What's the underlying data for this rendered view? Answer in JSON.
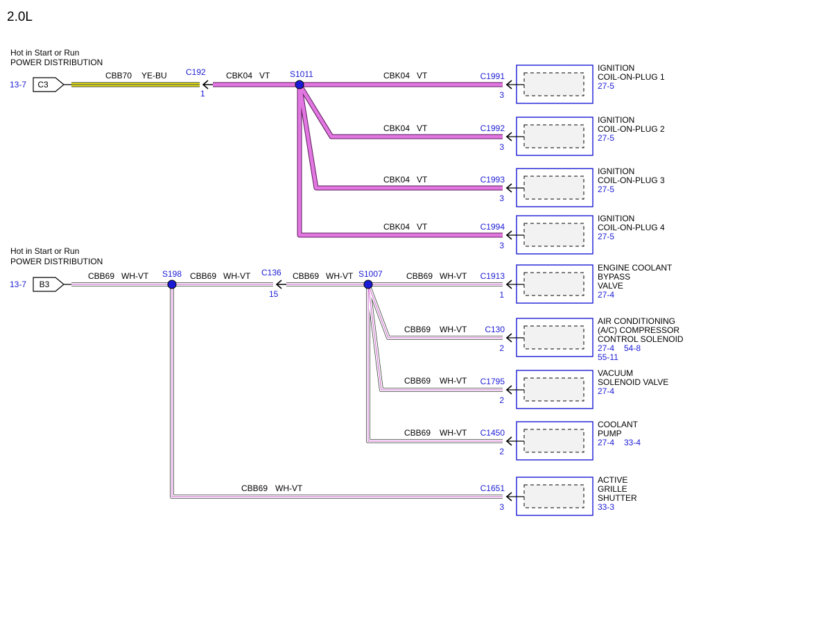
{
  "diagram": {
    "title": "2.0L",
    "sources": [
      {
        "id": "c3",
        "line1": "Hot in Start or Run",
        "line2": "POWER DISTRIBUTION",
        "ref": "13-7",
        "terminal": "C3"
      },
      {
        "id": "b3",
        "line1": "Hot in Start or Run",
        "line2": "POWER DISTRIBUTION",
        "ref": "13-7",
        "terminal": "B3"
      }
    ],
    "circuits": {
      "cbb70": "CBB70",
      "cbb70_color": "YE-BU",
      "cbk04": "CBK04",
      "cbk04_color": "VT",
      "cbb69": "CBB69",
      "cbb69_color": "WH-VT"
    },
    "connectors": {
      "c192": "C192",
      "c192_pin": "1",
      "c136": "C136",
      "c136_pin": "15"
    },
    "splices": {
      "s1011": "S1011",
      "s198": "S198",
      "s1007": "S1007"
    },
    "components": [
      {
        "connector": "C1991",
        "pin": "3",
        "name": [
          "IGNITION",
          "COIL-ON-PLUG 1"
        ],
        "refs": [
          "27-5"
        ]
      },
      {
        "connector": "C1992",
        "pin": "3",
        "name": [
          "IGNITION",
          "COIL-ON-PLUG 2"
        ],
        "refs": [
          "27-5"
        ]
      },
      {
        "connector": "C1993",
        "pin": "3",
        "name": [
          "IGNITION",
          "COIL-ON-PLUG 3"
        ],
        "refs": [
          "27-5"
        ]
      },
      {
        "connector": "C1994",
        "pin": "3",
        "name": [
          "IGNITION",
          "COIL-ON-PLUG 4"
        ],
        "refs": [
          "27-5"
        ]
      },
      {
        "connector": "C1913",
        "pin": "1",
        "name": [
          "ENGINE COOLANT",
          "BYPASS",
          "VALVE"
        ],
        "refs": [
          "27-4"
        ]
      },
      {
        "connector": "C130",
        "pin": "2",
        "name": [
          "AIR CONDITIONING",
          "(A/C) COMPRESSOR",
          "CONTROL SOLENOID"
        ],
        "refs": [
          "27-4",
          "54-8",
          "55-11"
        ]
      },
      {
        "connector": "C1795",
        "pin": "2",
        "name": [
          "VACUUM",
          "SOLENOID VALVE"
        ],
        "refs": [
          "27-4"
        ]
      },
      {
        "connector": "C1450",
        "pin": "2",
        "name": [
          "COOLANT",
          "PUMP"
        ],
        "refs": [
          "27-4",
          "33-4"
        ]
      },
      {
        "connector": "C1651",
        "pin": "3",
        "name": [
          "ACTIVE",
          "GRILLE",
          "SHUTTER"
        ],
        "refs": [
          "33-3"
        ]
      }
    ]
  }
}
